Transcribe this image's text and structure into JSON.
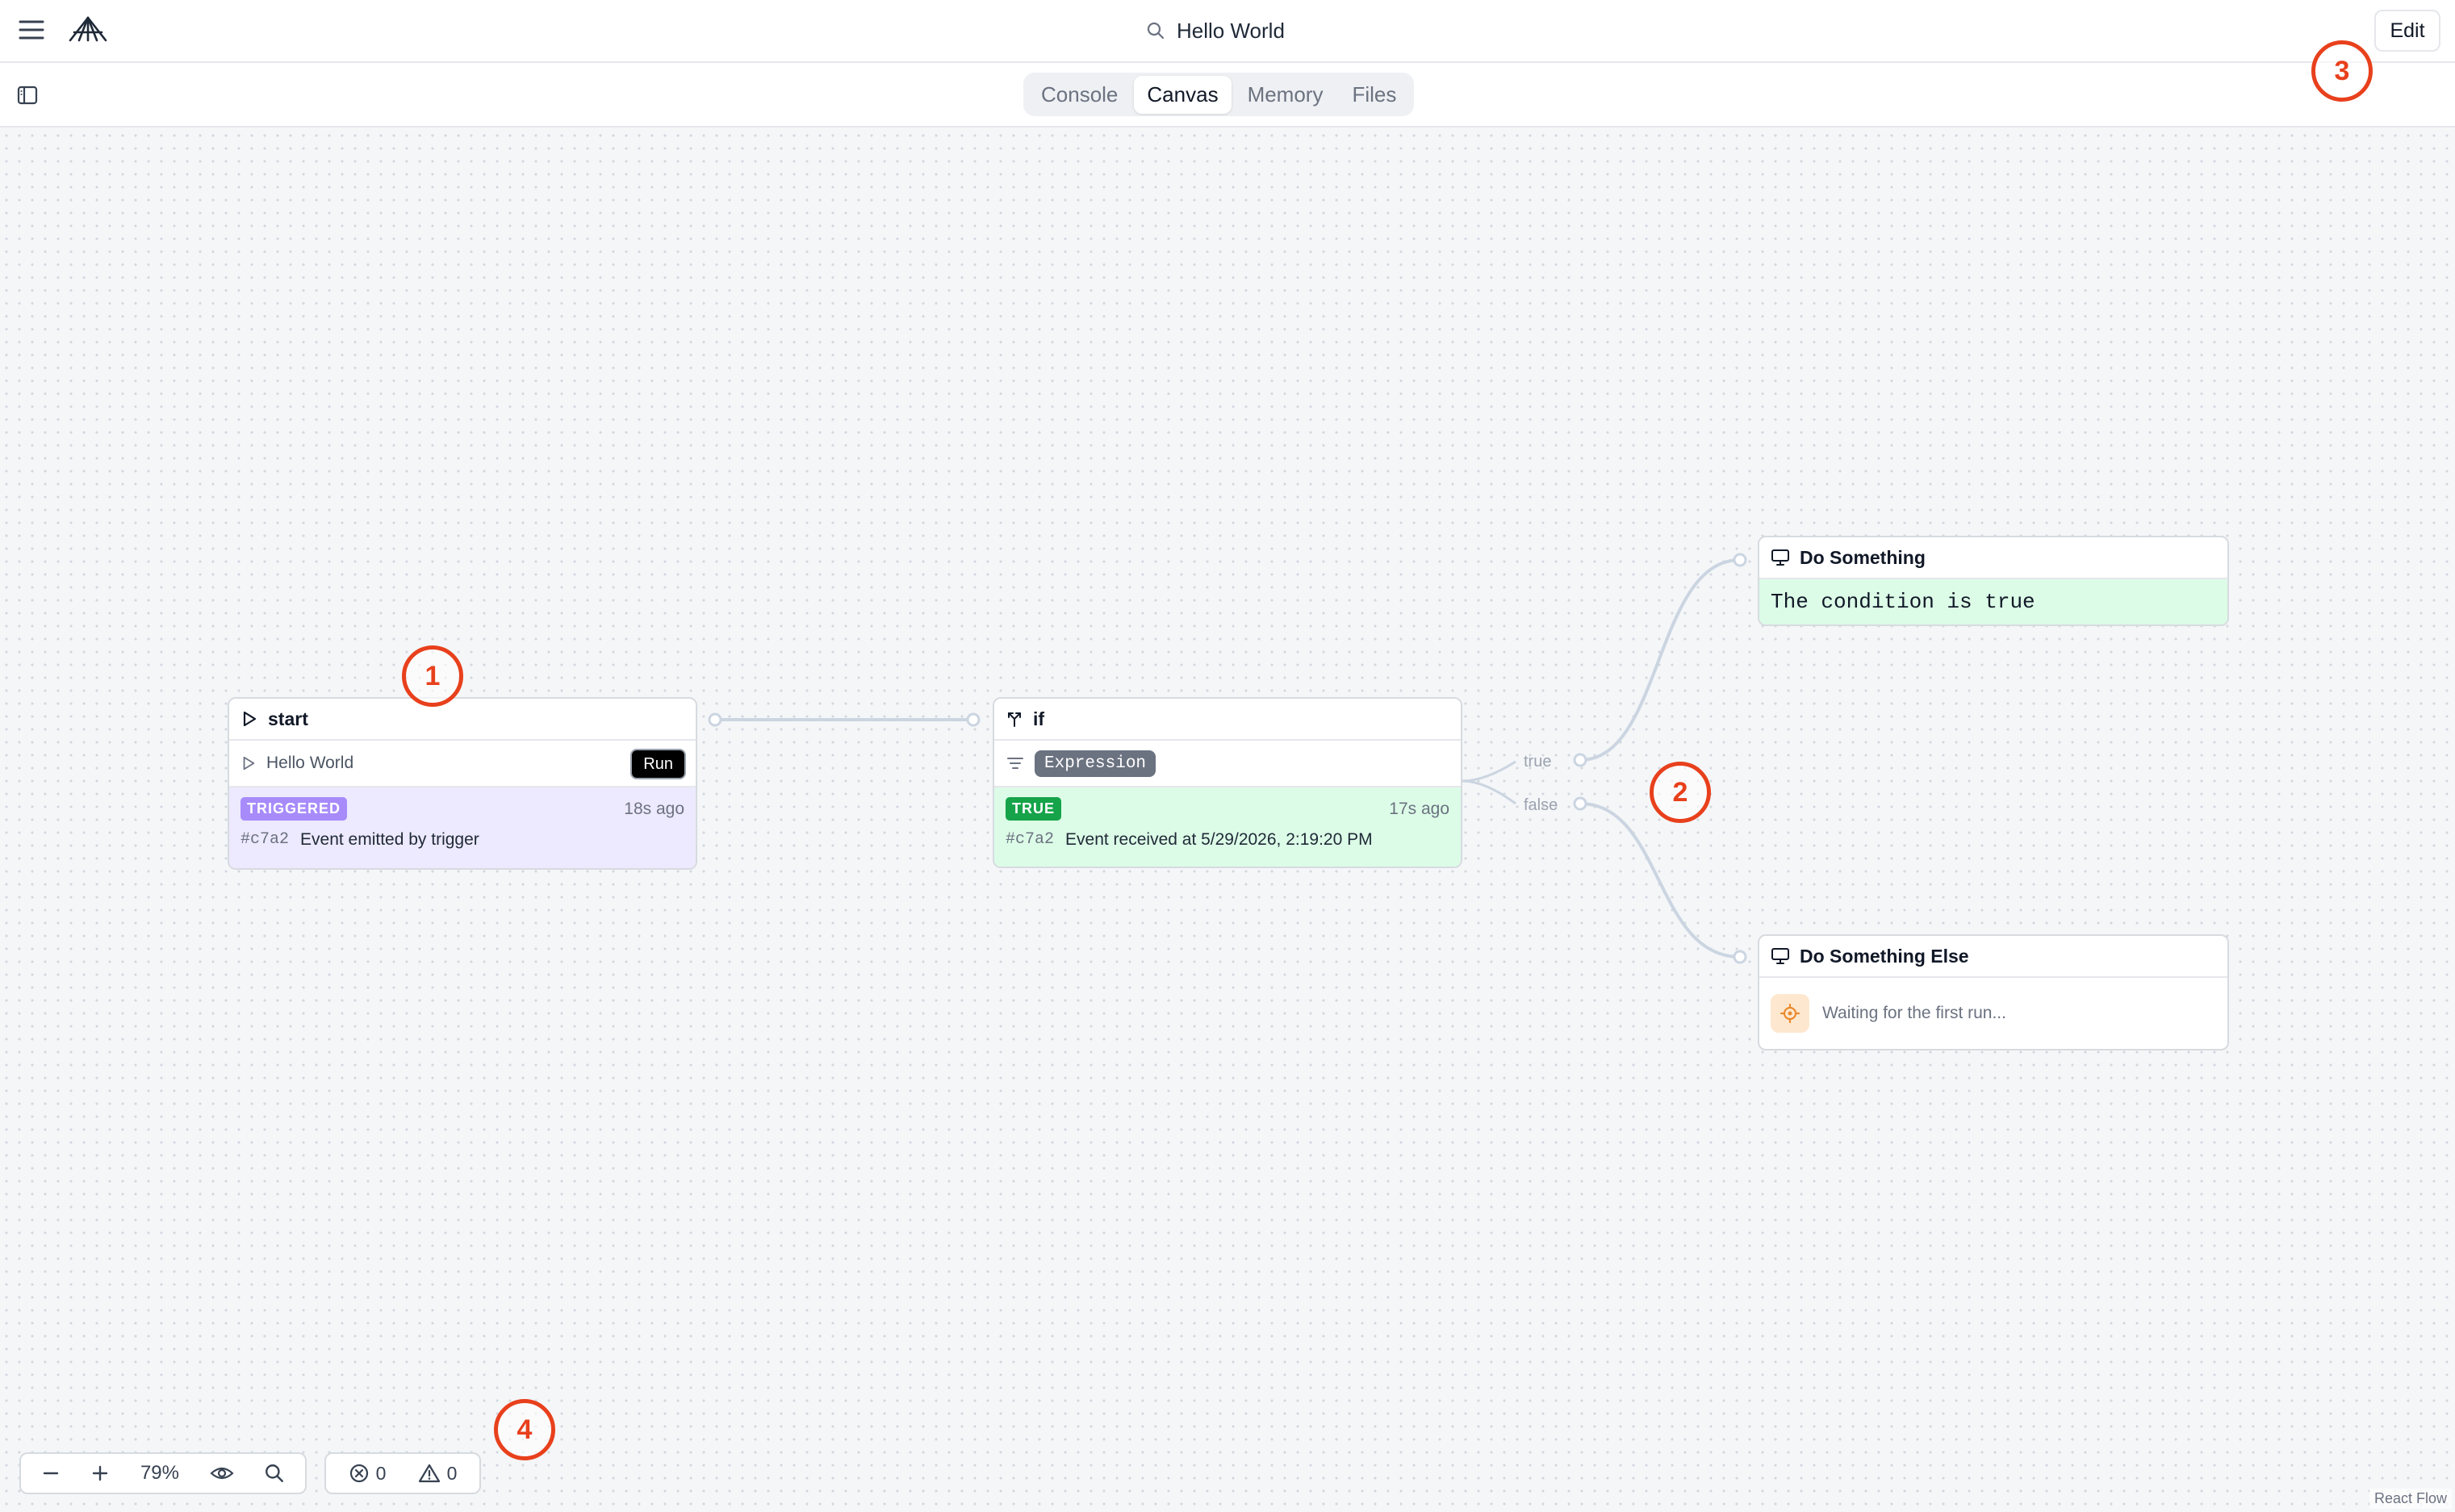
{
  "topbar": {
    "title": "Hello World",
    "edit_label": "Edit"
  },
  "tabs": [
    {
      "label": "Console",
      "active": false
    },
    {
      "label": "Canvas",
      "active": true
    },
    {
      "label": "Memory",
      "active": false
    },
    {
      "label": "Files",
      "active": false
    }
  ],
  "nodes": {
    "start": {
      "title": "start",
      "trigger_label": "Hello World",
      "run_label": "Run",
      "badge": "TRIGGERED",
      "time_ago": "18s ago",
      "hash": "#c7a2",
      "message": "Event emitted by trigger"
    },
    "if": {
      "title": "if",
      "expression_label": "Expression",
      "badge": "TRUE",
      "time_ago": "17s ago",
      "hash": "#c7a2",
      "message": "Event received at 5/29/2026, 2:19:20 PM"
    },
    "do_something": {
      "title": "Do Something",
      "output": "The condition is true"
    },
    "do_something_else": {
      "title": "Do Something Else",
      "waiting_text": "Waiting for the first run..."
    }
  },
  "edges": {
    "true_label": "true",
    "false_label": "false"
  },
  "annotations": [
    "1",
    "2",
    "3",
    "4"
  ],
  "controls": {
    "zoom": "79%",
    "errors": "0",
    "warnings": "0"
  },
  "attribution": "React Flow",
  "colors": {
    "annotation": "#e8401c",
    "triggered_bg": "#ede9fe",
    "success_bg": "#dcfce7",
    "edge": "#cbd5e1"
  }
}
